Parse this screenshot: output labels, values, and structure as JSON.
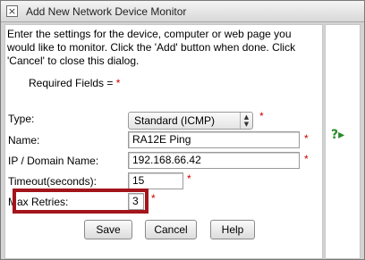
{
  "window": {
    "title": "Add New Network Device Monitor",
    "close_symbol": "×"
  },
  "intro_text": "Enter the settings for the device, computer or web page you would like to monitor. Click the 'Add' button when done. Click 'Cancel' to close this dialog.",
  "required_fields_label": "Required Fields =",
  "required_star": "*",
  "form": {
    "type_label": "Type:",
    "type_value": "Standard (ICMP)",
    "name_label": "Name:",
    "name_value": "RA12E Ping",
    "ip_label": "IP / Domain Name:",
    "ip_value": "192.168.66.42",
    "timeout_label": "Timeout(seconds):",
    "timeout_value": "15",
    "retries_label": "Max Retries:",
    "retries_value": "3"
  },
  "buttons": {
    "save": "Save",
    "cancel": "Cancel",
    "help": "Help"
  },
  "icons": {
    "help": "help-arrow-icon",
    "select_arrows": "updown-arrows-icon"
  },
  "colors": {
    "required_star": "#cc0000",
    "highlight_box": "#a3151b",
    "help_icon": "#2a8a2a"
  }
}
